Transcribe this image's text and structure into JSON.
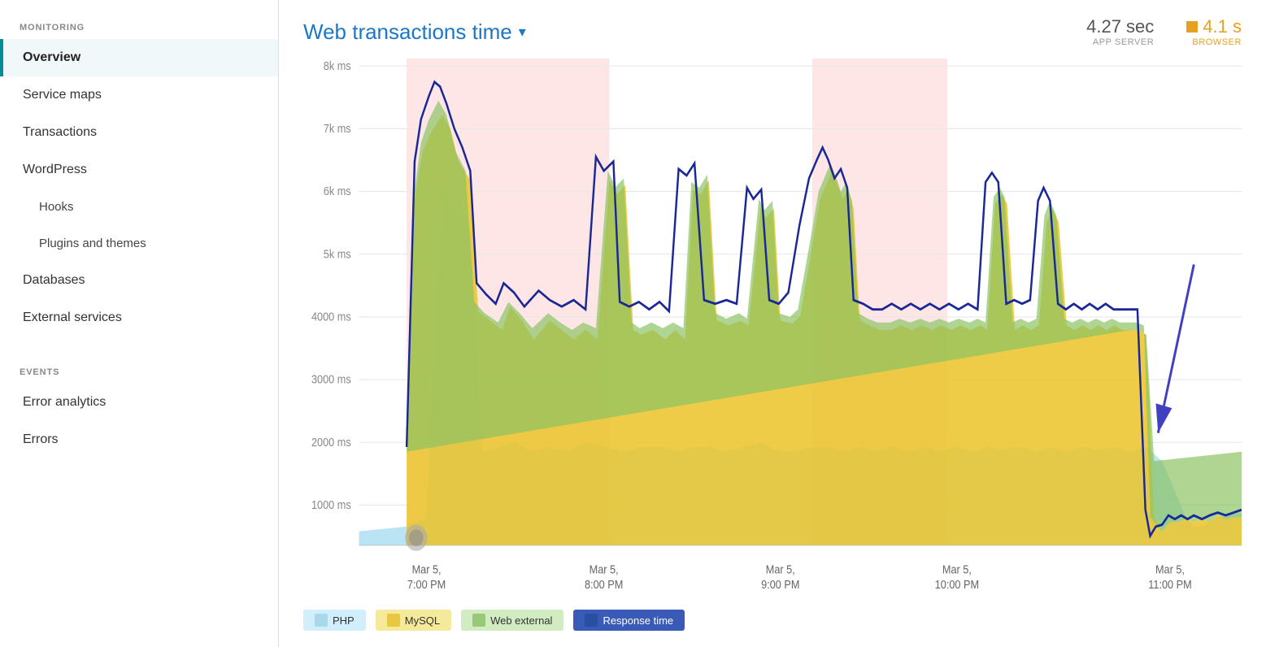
{
  "sidebar": {
    "monitoring_label": "MONITORING",
    "events_label": "EVENTS",
    "items": [
      {
        "label": "Overview",
        "id": "overview",
        "active": true,
        "sub": false
      },
      {
        "label": "Service maps",
        "id": "service-maps",
        "active": false,
        "sub": false
      },
      {
        "label": "Transactions",
        "id": "transactions",
        "active": false,
        "sub": false
      },
      {
        "label": "WordPress",
        "id": "wordpress",
        "active": false,
        "sub": false
      },
      {
        "label": "Hooks",
        "id": "hooks",
        "active": false,
        "sub": true
      },
      {
        "label": "Plugins and themes",
        "id": "plugins-themes",
        "active": false,
        "sub": true
      },
      {
        "label": "Databases",
        "id": "databases",
        "active": false,
        "sub": false
      },
      {
        "label": "External services",
        "id": "external-services",
        "active": false,
        "sub": false
      }
    ],
    "event_items": [
      {
        "label": "Error analytics",
        "id": "error-analytics",
        "active": false
      },
      {
        "label": "Errors",
        "id": "errors",
        "active": false
      }
    ]
  },
  "header": {
    "chart_title": "Web transactions time",
    "dropdown_symbol": "▾",
    "app_server_value": "4.27 sec",
    "app_server_label": "APP SERVER",
    "browser_value": "4.1 s",
    "browser_label": "BROWSER"
  },
  "y_axis": {
    "labels": [
      "8k ms",
      "7k ms",
      "6k ms",
      "5k ms",
      "4000 ms",
      "3000 ms",
      "2000 ms",
      "1000 ms"
    ]
  },
  "x_axis": {
    "labels": [
      "Mar 5,\n7:00 PM",
      "Mar 5,\n8:00 PM",
      "Mar 5,\n9:00 PM",
      "Mar 5,\n10:00 PM",
      "Mar 5,\n11:00 PM"
    ]
  },
  "legend": {
    "items": [
      {
        "label": "PHP",
        "color_class": "legend-php"
      },
      {
        "label": "MySQL",
        "color_class": "legend-mysql"
      },
      {
        "label": "Web external",
        "color_class": "legend-webext"
      },
      {
        "label": "Response time",
        "color_class": "legend-response"
      }
    ]
  },
  "icons": {
    "dropdown": "▾"
  }
}
